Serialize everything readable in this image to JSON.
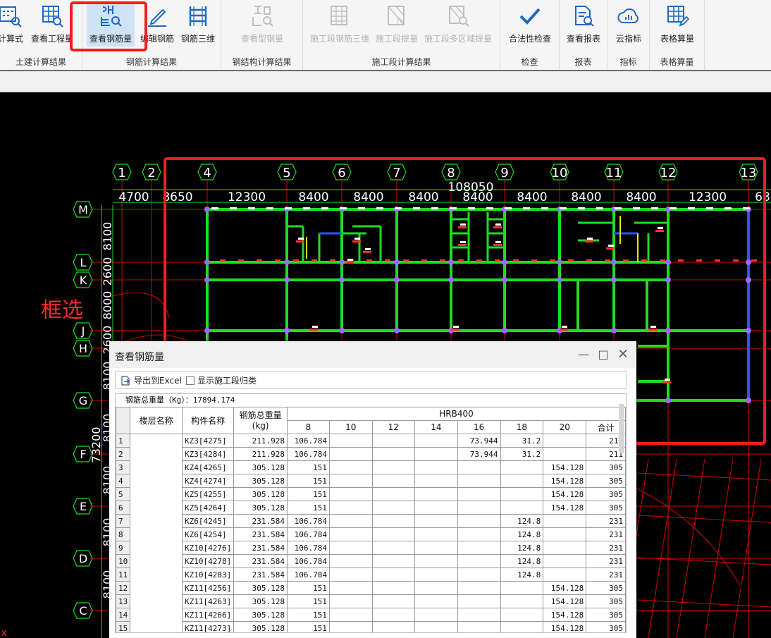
{
  "ribbon": {
    "groups": [
      {
        "label": "土建计算结果",
        "buttons": [
          "计算式",
          "查看工程量"
        ]
      },
      {
        "label": "钢筋计算结果",
        "buttons": [
          "查看钢筋量",
          "编辑钢筋",
          "钢筋三维"
        ]
      },
      {
        "label": "钢结构计算结果",
        "buttons": [
          "查看型钢量"
        ]
      },
      {
        "label": "施工段计算结果",
        "buttons": [
          "施工段钢筋三维",
          "施工段提量",
          "施工段多区域提量"
        ]
      },
      {
        "label": "检查",
        "buttons": [
          "合法性检查"
        ]
      },
      {
        "label": "报表",
        "buttons": [
          "查看报表"
        ]
      },
      {
        "label": "指标",
        "buttons": [
          "云指标"
        ]
      },
      {
        "label": "表格算量",
        "buttons": [
          "表格算量"
        ]
      }
    ]
  },
  "cad": {
    "annotation": "框选",
    "axes_top": [
      "1",
      "2",
      "4",
      "5",
      "6",
      "7",
      "8",
      "9",
      "10",
      "11",
      "12",
      "13"
    ],
    "spans_top": [
      "4700",
      "8650",
      "12300",
      "8400",
      "8400",
      "8400",
      "8400",
      "8400",
      "8400",
      "8400",
      "12300",
      "68"
    ],
    "overall_top": "108050",
    "axes_left": [
      "M",
      "L",
      "K",
      "J",
      "H",
      "G",
      "F",
      "E",
      "D",
      "C"
    ],
    "spans_left": [
      "8100",
      "2600",
      "8000",
      "2600",
      "8100",
      "8100",
      "8100",
      "8100",
      "8100"
    ],
    "overall_left": "73200",
    "x_mark": "x"
  },
  "dialog": {
    "title": "查看钢筋量",
    "export_label": "导出到Excel",
    "checkbox_label": "显示施工段归类",
    "total_label": "钢筋总重量（Kg）：17894.174",
    "col_floor": "楼层名称",
    "col_name": "构件名称",
    "col_weight": "钢筋总重量\n(kg)",
    "col_group": "HRB400",
    "diameters": [
      "8",
      "10",
      "12",
      "14",
      "16",
      "18",
      "20",
      "合计"
    ],
    "rows": [
      {
        "n": "1",
        "name": "KZ3[4275]",
        "w": "211.928",
        "d8": "106.784",
        "d16": "73.944",
        "d18": "31.2",
        "d20": "",
        "sum": "211"
      },
      {
        "n": "2",
        "name": "KZ3[4284]",
        "w": "211.928",
        "d8": "106.784",
        "d16": "73.944",
        "d18": "31.2",
        "d20": "",
        "sum": "211"
      },
      {
        "n": "3",
        "name": "KZ4[4265]",
        "w": "305.128",
        "d8": "151",
        "d16": "",
        "d18": "",
        "d20": "154.128",
        "sum": "305"
      },
      {
        "n": "4",
        "name": "KZ4[4274]",
        "w": "305.128",
        "d8": "151",
        "d16": "",
        "d18": "",
        "d20": "154.128",
        "sum": "305"
      },
      {
        "n": "5",
        "name": "KZ5[4255]",
        "w": "305.128",
        "d8": "151",
        "d16": "",
        "d18": "",
        "d20": "154.128",
        "sum": "305"
      },
      {
        "n": "6",
        "name": "KZ5[4264]",
        "w": "305.128",
        "d8": "151",
        "d16": "",
        "d18": "",
        "d20": "154.128",
        "sum": "305"
      },
      {
        "n": "7",
        "name": "KZ6[4245]",
        "w": "231.584",
        "d8": "106.784",
        "d16": "",
        "d18": "124.8",
        "d20": "",
        "sum": "231"
      },
      {
        "n": "8",
        "name": "KZ6[4254]",
        "w": "231.584",
        "d8": "106.784",
        "d16": "",
        "d18": "124.8",
        "d20": "",
        "sum": "231"
      },
      {
        "n": "9",
        "name": "KZ10[4276]",
        "w": "231.584",
        "d8": "106.784",
        "d16": "",
        "d18": "124.8",
        "d20": "",
        "sum": "231"
      },
      {
        "n": "10",
        "name": "KZ10[4278]",
        "w": "231.584",
        "d8": "106.784",
        "d16": "",
        "d18": "124.8",
        "d20": "",
        "sum": "231"
      },
      {
        "n": "11",
        "name": "KZ10[4283]",
        "w": "231.584",
        "d8": "106.784",
        "d16": "",
        "d18": "124.8",
        "d20": "",
        "sum": "231"
      },
      {
        "n": "12",
        "name": "KZ11[4256]",
        "w": "305.128",
        "d8": "151",
        "d16": "",
        "d18": "",
        "d20": "154.128",
        "sum": "305"
      },
      {
        "n": "13",
        "name": "KZ11[4263]",
        "w": "305.128",
        "d8": "151",
        "d16": "",
        "d18": "",
        "d20": "154.128",
        "sum": "305"
      },
      {
        "n": "14",
        "name": "KZ11[4266]",
        "w": "305.128",
        "d8": "151",
        "d16": "",
        "d18": "",
        "d20": "154.128",
        "sum": "305"
      },
      {
        "n": "15",
        "name": "KZ11[4273]",
        "w": "305.128",
        "d8": "151",
        "d16": "",
        "d18": "",
        "d20": "154.128",
        "sum": "305"
      }
    ]
  },
  "colors": {
    "highlight": "#f21d1d",
    "grid_green": "#1fdd1f",
    "axis_red": "#d40000",
    "selected_btn": "#cfe3f7"
  }
}
